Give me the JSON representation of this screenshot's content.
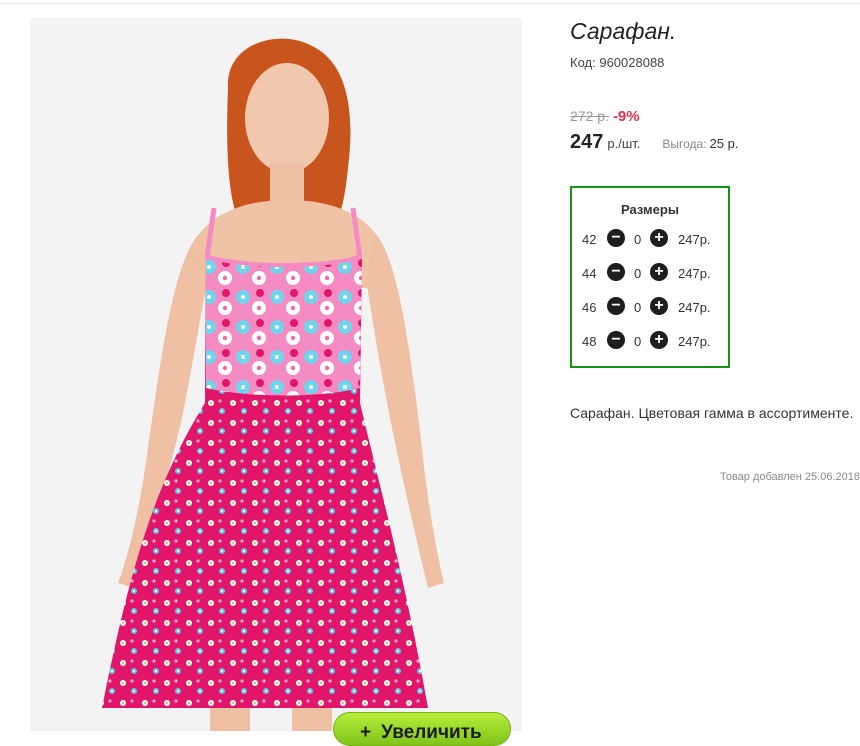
{
  "product": {
    "title": "Сарафан.",
    "code_label": "Код:",
    "code": "960028088",
    "old_price": "272 р.",
    "discount": "-9%",
    "price": "247",
    "price_unit": "р./шт.",
    "savings_label": "Выгода:",
    "savings_value": "25 р.",
    "description": "Сарафан. Цветовая гамма в ассортименте.",
    "added": "Товар добавлен 25.06.2018",
    "zoom_label": "Увеличить",
    "zoom_icon": "+"
  },
  "sizes": {
    "title": "Размеры",
    "rows": [
      {
        "size": "42",
        "qty": "0",
        "price": "247р."
      },
      {
        "size": "44",
        "qty": "0",
        "price": "247р."
      },
      {
        "size": "46",
        "qty": "0",
        "price": "247р."
      },
      {
        "size": "48",
        "qty": "0",
        "price": "247р."
      }
    ],
    "minus_icon": "−",
    "plus_icon": "+"
  },
  "colors": {
    "accent_border": "#179313",
    "discount": "#e0334f",
    "zoom_button": "#8fd21f"
  }
}
